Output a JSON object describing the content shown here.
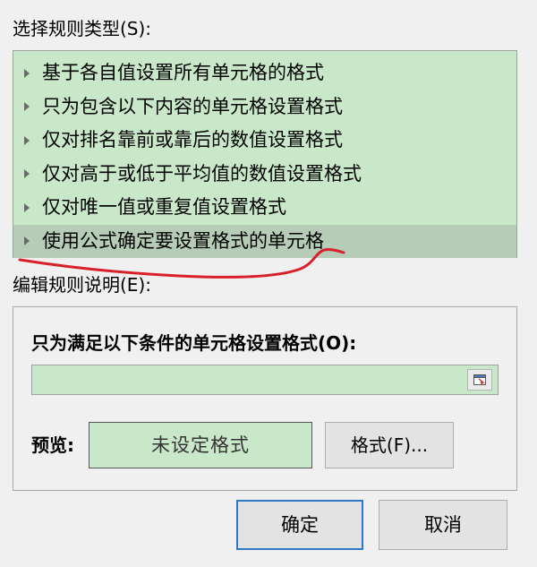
{
  "rule_type": {
    "label": "选择规则类型(S):",
    "items": [
      {
        "label": "基于各自值设置所有单元格的格式"
      },
      {
        "label": "只为包含以下内容的单元格设置格式"
      },
      {
        "label": "仅对排名靠前或靠后的数值设置格式"
      },
      {
        "label": "仅对高于或低于平均值的数值设置格式"
      },
      {
        "label": "仅对唯一值或重复值设置格式"
      },
      {
        "label": "使用公式确定要设置格式的单元格",
        "selected": true
      }
    ]
  },
  "edit_rule": {
    "label": "编辑规则说明(E):",
    "condition_label": "只为满足以下条件的单元格设置格式(O):",
    "formula_value": "",
    "preview_label": "预览:",
    "preview_text": "未设定格式",
    "format_button": "格式(F)..."
  },
  "footer": {
    "ok_label": "确定",
    "cancel_label": "取消"
  },
  "colors": {
    "list_background": "#c9e8c9",
    "selected_row": "#b6ccb6",
    "ok_border": "#2f78c8",
    "annotation": "#d9202a"
  },
  "icons": {
    "tree_arrow": "triangle-right",
    "reference": "collapse-dialog-icon"
  }
}
